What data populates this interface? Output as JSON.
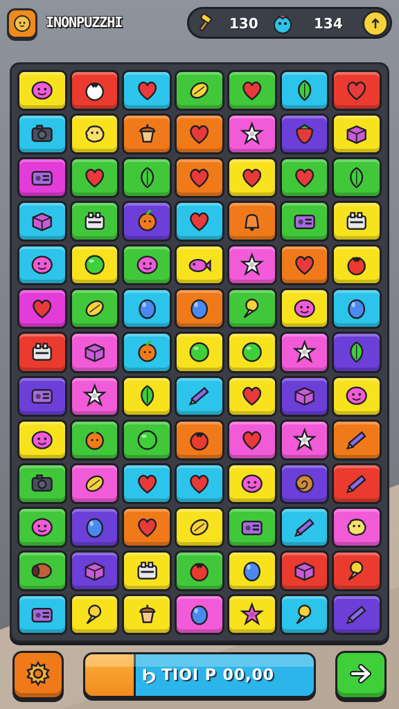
{
  "header": {
    "title": "INONPUZZHI",
    "logo_icon": "cat-face-icon",
    "stat_left_icon": "hammer-icon",
    "stat_left_value": "130",
    "stat_right_icon": "blue-creature-icon",
    "stat_right_value": "134",
    "coin_icon": "coin-icon"
  },
  "board": {
    "columns": 7,
    "rows": 13,
    "tiles": [
      [
        [
          "#f8e21e",
          "smiley"
        ],
        [
          "#ea3b2e",
          "tomato"
        ],
        [
          "#2cc4ea",
          "heart"
        ],
        [
          "#41c83a",
          "lemon"
        ],
        [
          "#41c83a",
          "heart"
        ],
        [
          "#2cc4ea",
          "leaf"
        ],
        [
          "#ea3b2e",
          "heart"
        ]
      ],
      [
        [
          "#2cc4ea",
          "camera"
        ],
        [
          "#f8e21e",
          "blob"
        ],
        [
          "#f07a1a",
          "acorn"
        ],
        [
          "#f07a1a",
          "heart"
        ],
        [
          "#f25bd8",
          "star"
        ],
        [
          "#6b3fd8",
          "strawberry"
        ],
        [
          "#f8e21e",
          "box"
        ]
      ],
      [
        [
          "#e43cd8",
          "radio"
        ],
        [
          "#41c83a",
          "heart"
        ],
        [
          "#41c83a",
          "leaf"
        ],
        [
          "#f07a1a",
          "heart"
        ],
        [
          "#f8e21e",
          "heart"
        ],
        [
          "#41c83a",
          "heart"
        ],
        [
          "#41c83a",
          "leaf"
        ]
      ],
      [
        [
          "#2cc4ea",
          "box"
        ],
        [
          "#41c83a",
          "toaster"
        ],
        [
          "#6b3fd8",
          "orange"
        ],
        [
          "#2cc4ea",
          "heart"
        ],
        [
          "#f07a1a",
          "bell"
        ],
        [
          "#41c83a",
          "radio"
        ],
        [
          "#f8e21e",
          "toaster"
        ]
      ],
      [
        [
          "#2cc4ea",
          "smiley"
        ],
        [
          "#f8e21e",
          "ball"
        ],
        [
          "#41c83a",
          "smiley"
        ],
        [
          "#f8e21e",
          "fish"
        ],
        [
          "#f25bd8",
          "star"
        ],
        [
          "#f07a1a",
          "heart"
        ],
        [
          "#f8e21e",
          "tomato"
        ]
      ],
      [
        [
          "#e43cd8",
          "heart"
        ],
        [
          "#41c83a",
          "lemon"
        ],
        [
          "#2cc4ea",
          "egg"
        ],
        [
          "#f07a1a",
          "egg"
        ],
        [
          "#41c83a",
          "pin"
        ],
        [
          "#f8e21e",
          "smiley"
        ],
        [
          "#2cc4ea",
          "egg"
        ]
      ],
      [
        [
          "#ea3b2e",
          "toaster"
        ],
        [
          "#f25bd8",
          "box"
        ],
        [
          "#2cc4ea",
          "orange"
        ],
        [
          "#f8e21e",
          "ball"
        ],
        [
          "#f8e21e",
          "ball"
        ],
        [
          "#f25bd8",
          "star"
        ],
        [
          "#6b3fd8",
          "leaf"
        ]
      ],
      [
        [
          "#6b3fd8",
          "radio"
        ],
        [
          "#f25bd8",
          "star"
        ],
        [
          "#f8e21e",
          "leaf"
        ],
        [
          "#2cc4ea",
          "pencil"
        ],
        [
          "#f8e21e",
          "heart"
        ],
        [
          "#6b3fd8",
          "box"
        ],
        [
          "#f8e21e",
          "smiley"
        ]
      ],
      [
        [
          "#f8e21e",
          "smiley"
        ],
        [
          "#41c83a",
          "orange"
        ],
        [
          "#41c83a",
          "ball"
        ],
        [
          "#f07a1a",
          "tomato"
        ],
        [
          "#f25bd8",
          "heart"
        ],
        [
          "#f25bd8",
          "star"
        ],
        [
          "#f07a1a",
          "pencil"
        ]
      ],
      [
        [
          "#41c83a",
          "camera"
        ],
        [
          "#f25bd8",
          "lemon"
        ],
        [
          "#2cc4ea",
          "heart"
        ],
        [
          "#2cc4ea",
          "heart"
        ],
        [
          "#f8e21e",
          "smiley"
        ],
        [
          "#6b3fd8",
          "shell"
        ],
        [
          "#ea3b2e",
          "pencil"
        ]
      ],
      [
        [
          "#41c83a",
          "smiley"
        ],
        [
          "#6b3fd8",
          "egg"
        ],
        [
          "#f07a1a",
          "heart"
        ],
        [
          "#f8e21e",
          "lemon"
        ],
        [
          "#41c83a",
          "radio"
        ],
        [
          "#2cc4ea",
          "pencil"
        ],
        [
          "#f25bd8",
          "blob"
        ]
      ],
      [
        [
          "#41c83a",
          "barrel"
        ],
        [
          "#6b3fd8",
          "box"
        ],
        [
          "#f8e21e",
          "toaster"
        ],
        [
          "#41c83a",
          "tomato"
        ],
        [
          "#f8e21e",
          "egg"
        ],
        [
          "#ea3b2e",
          "box"
        ],
        [
          "#ea3b2e",
          "pin"
        ]
      ],
      [
        [
          "#2cc4ea",
          "radio"
        ],
        [
          "#f8e21e",
          "pin"
        ],
        [
          "#f8e21e",
          "acorn"
        ],
        [
          "#f25bd8",
          "egg"
        ],
        [
          "#f8e21e",
          "star"
        ],
        [
          "#2cc4ea",
          "pin"
        ],
        [
          "#6b3fd8",
          "pencil"
        ]
      ]
    ]
  },
  "footer": {
    "settings_icon": "gear-icon",
    "next_icon": "arrow-right-icon",
    "progress_icon": "bolt-icon",
    "progress_glyph": "Ϧ",
    "progress_text": "TIOI P 00,00",
    "progress_fraction": 0.22
  }
}
